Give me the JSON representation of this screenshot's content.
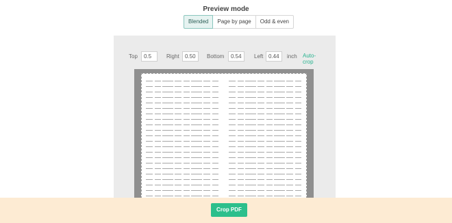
{
  "preview": {
    "title": "Preview mode",
    "modes": [
      "Blended",
      "Page by page",
      "Odd & even"
    ],
    "active_mode": "Blended"
  },
  "crop": {
    "top_label": "Top",
    "top_value": "0.5",
    "right_label": "Right",
    "right_value": "0.50",
    "bottom_label": "Bottom",
    "bottom_value": "0.54",
    "left_label": "Left",
    "left_value": "0.44",
    "unit": "inch",
    "autocrop_label": "Auto-crop"
  },
  "action": {
    "crop_label": "Crop PDF"
  },
  "colors": {
    "accent": "#2cbf8c",
    "autocrop": "#27b38f",
    "bottom_bar": "#fdebd3",
    "panel": "#ebebeb"
  }
}
